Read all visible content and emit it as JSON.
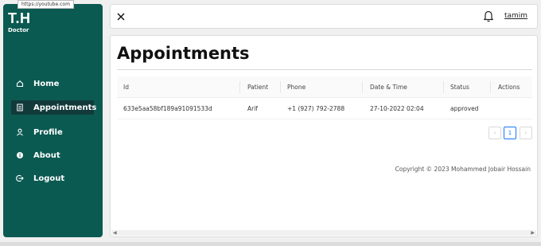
{
  "browser": {
    "status_url": "https://youtube.com"
  },
  "sidebar": {
    "logo": "T.H",
    "role": "Doctor",
    "items": [
      {
        "label": "Home",
        "icon": "home-icon",
        "active": false
      },
      {
        "label": "Appointments",
        "icon": "document-icon",
        "active": true
      },
      {
        "label": "Profile",
        "icon": "user-icon",
        "active": false
      },
      {
        "label": "About",
        "icon": "info-icon",
        "active": false
      },
      {
        "label": "Logout",
        "icon": "logout-icon",
        "active": false
      }
    ]
  },
  "topbar": {
    "close_icon": "close-icon",
    "bell_icon": "bell-icon",
    "username": "tamim"
  },
  "main": {
    "title": "Appointments",
    "table": {
      "headers": [
        "Id",
        "Patient",
        "Phone",
        "Date & Time",
        "Status",
        "Actions"
      ],
      "rows": [
        [
          "633e5aa58bf189a91091533d",
          "Arif",
          "+1 (927) 792-2788",
          "27-10-2022 02:04",
          "approved",
          ""
        ]
      ]
    },
    "pagination": {
      "prev": "‹",
      "current": "1",
      "next": "›"
    },
    "footer": "Copyright © 2023 Mohammed Jobair Hossain"
  },
  "colors": {
    "sidebar_bg": "#0b5a52",
    "active_item_bg": "#123a3b",
    "pager_accent": "#1677ff"
  }
}
